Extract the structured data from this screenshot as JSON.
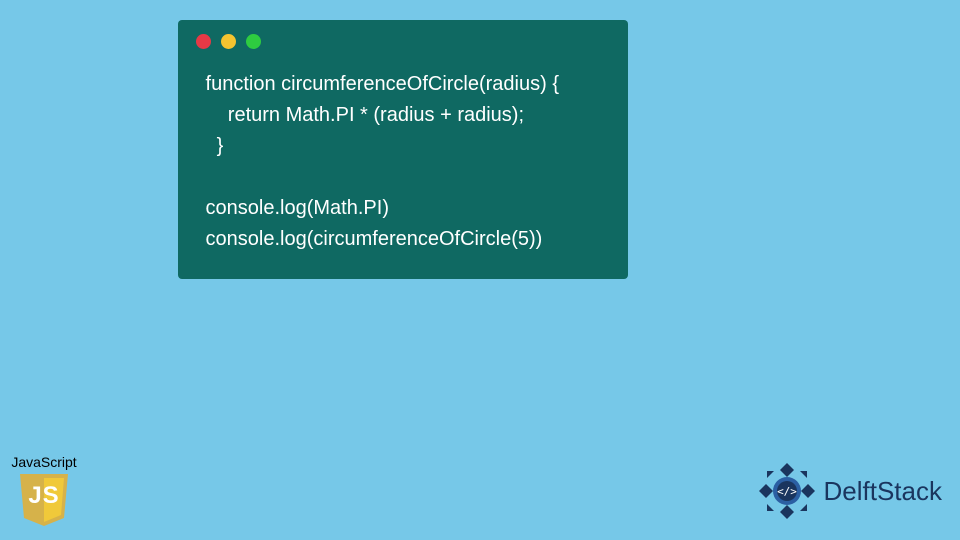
{
  "code": {
    "line1": " function circumferenceOfCircle(radius) {",
    "line2": "     return Math.PI * (radius + radius);",
    "line3": "   }",
    "line4": "",
    "line5": " console.log(Math.PI)",
    "line6": " console.log(circumferenceOfCircle(5))"
  },
  "badges": {
    "js_label": "JavaScript",
    "js_logo_text": "JS",
    "delftstack_text": "DelftStack"
  },
  "colors": {
    "background": "#76c8e8",
    "window": "#0f6962",
    "dot_red": "#e63946",
    "dot_yellow": "#f4c430",
    "dot_green": "#2ecc40",
    "code_text": "#ffffff",
    "js_shield_left": "#d6b24a",
    "js_shield_right": "#f0c93a",
    "delft_primary": "#1a355e"
  }
}
